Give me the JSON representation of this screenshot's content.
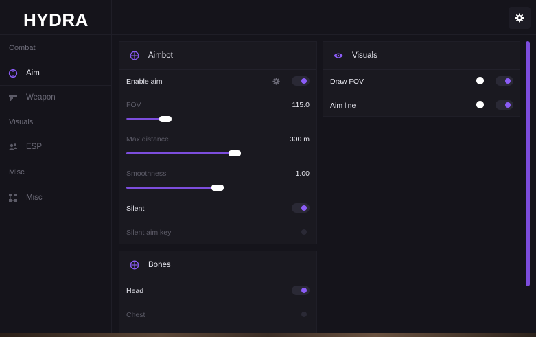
{
  "app": {
    "title": "HYDRA"
  },
  "sidebar": {
    "sections": [
      {
        "label": "Combat",
        "items": [
          {
            "label": "Aim",
            "icon": "crosshair-icon",
            "active": true
          },
          {
            "label": "Weapon",
            "icon": "gun-icon",
            "active": false
          }
        ]
      },
      {
        "label": "Visuals",
        "items": [
          {
            "label": "ESP",
            "icon": "users-icon",
            "active": false
          }
        ]
      },
      {
        "label": "Misc",
        "items": [
          {
            "label": "Misc",
            "icon": "nodes-icon",
            "active": false
          }
        ]
      }
    ]
  },
  "header": {
    "settings_icon": "gear-icon"
  },
  "aimbot": {
    "title": "Aimbot",
    "icon": "crosshair-icon",
    "enable_aim": {
      "label": "Enable aim",
      "enabled": true
    },
    "fov": {
      "label": "FOV",
      "value": "115.0",
      "fraction": 0.31
    },
    "max_distance": {
      "label": "Max distance",
      "value": "300 m",
      "fraction": 0.6
    },
    "smoothness": {
      "label": "Smoothness",
      "value": "1.00",
      "fraction": 0.5
    },
    "silent": {
      "label": "Silent",
      "enabled": true
    },
    "silent_aim_key": {
      "label": "Silent aim key",
      "enabled": false
    }
  },
  "bones": {
    "title": "Bones",
    "icon": "crosshair-icon",
    "head": {
      "label": "Head",
      "enabled": true
    },
    "chest": {
      "label": "Chest",
      "enabled": false
    }
  },
  "visuals": {
    "title": "Visuals",
    "icon": "eye-icon",
    "draw_fov": {
      "label": "Draw FOV",
      "enabled": true
    },
    "aim_line": {
      "label": "Aim line",
      "enabled": true
    }
  },
  "colors": {
    "accent": "#8b5cf6",
    "background": "#15141b",
    "panel": "#1a1920"
  }
}
